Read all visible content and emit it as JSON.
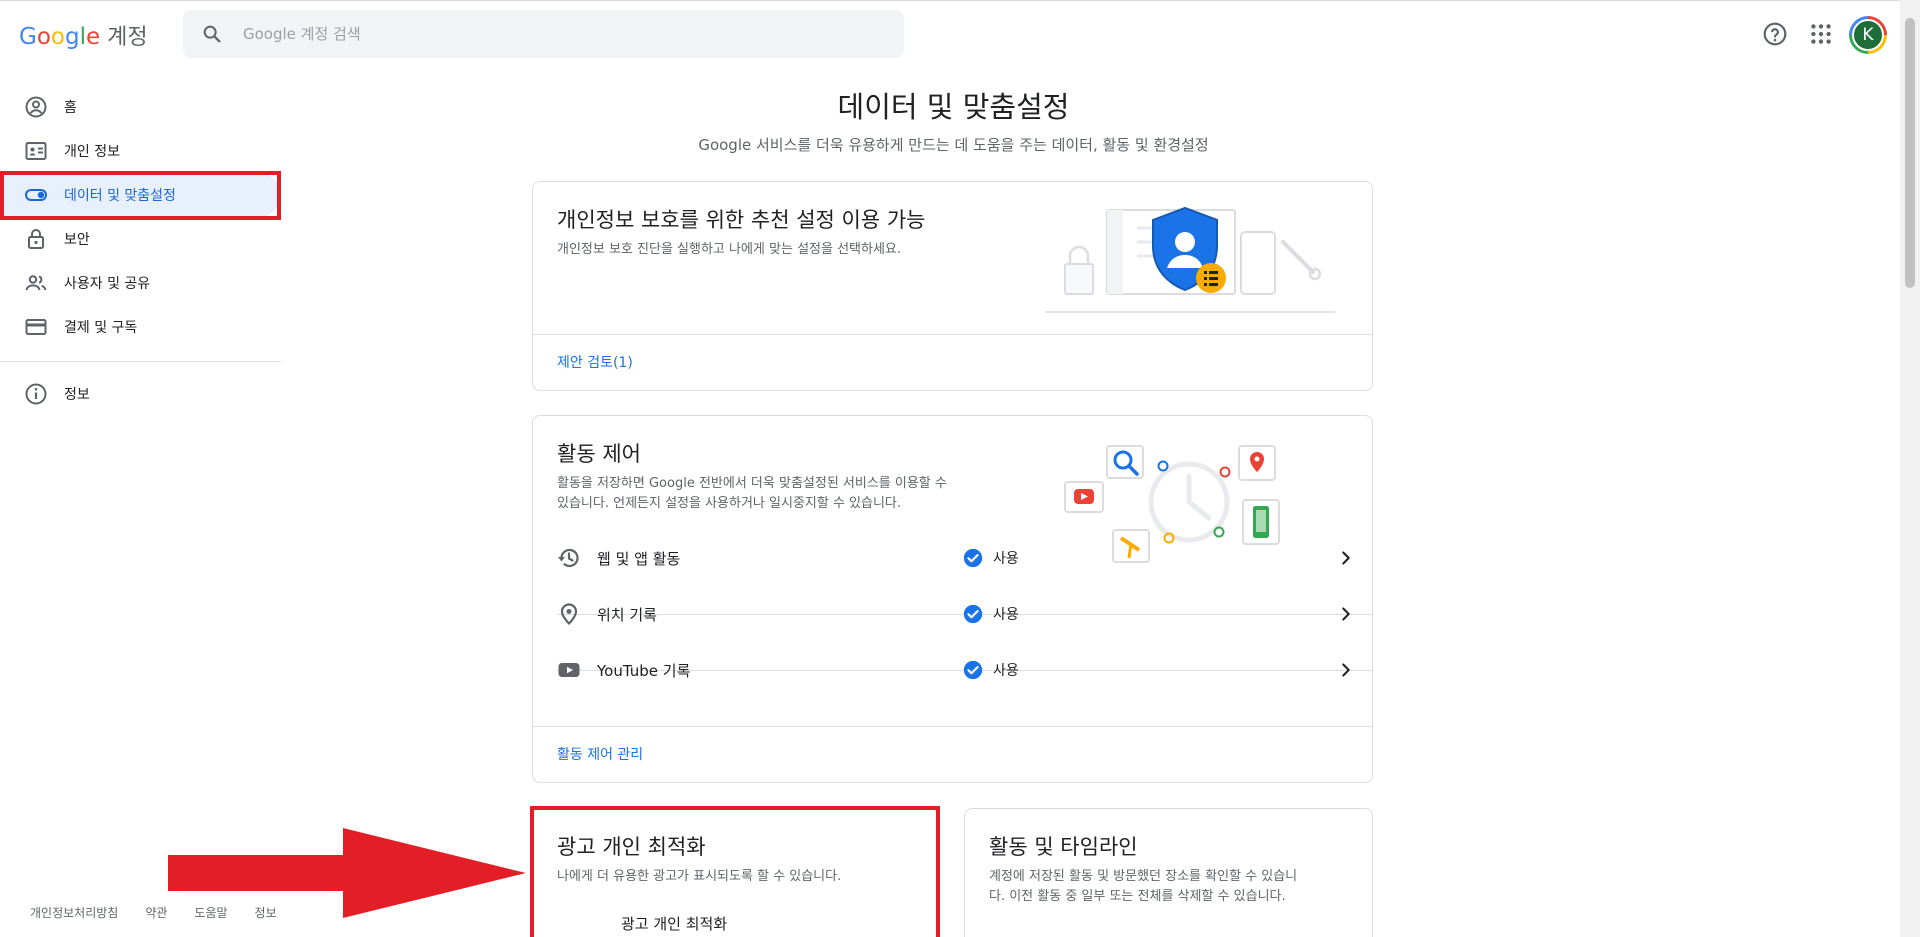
{
  "header": {
    "logo_google": [
      "G",
      "o",
      "o",
      "g",
      "l",
      "e"
    ],
    "product": "계정",
    "search_placeholder": "Google 계정 검색",
    "avatar_letter": "K"
  },
  "sidebar": {
    "items": [
      {
        "label": "홈",
        "icon": "account-circle-icon"
      },
      {
        "label": "개인 정보",
        "icon": "id-card-icon"
      },
      {
        "label": "데이터 및 맞춤설정",
        "icon": "toggle-icon",
        "active": true
      },
      {
        "label": "보안",
        "icon": "lock-icon"
      },
      {
        "label": "사용자 및 공유",
        "icon": "people-icon"
      },
      {
        "label": "결제 및 구독",
        "icon": "credit-card-icon"
      }
    ],
    "info_item": {
      "label": "정보",
      "icon": "info-icon"
    },
    "footer": [
      "개인정보처리방침",
      "약관",
      "도움말",
      "정보"
    ]
  },
  "main": {
    "title": "데이터 및 맞춤설정",
    "subtitle": "Google 서비스를 더욱 유용하게 만드는 데 도움을 주는 데이터, 활동 및 환경설정",
    "privacy_card": {
      "title": "개인정보 보호를 위한 추천 설정 이용 가능",
      "desc": "개인정보 보호 진단을 실행하고 나에게 맞는 설정을 선택하세요.",
      "link": "제안 검토(1)"
    },
    "activity_card": {
      "title": "활동 제어",
      "desc_line1": "활동을 저장하면 Google 전반에서 더욱 맞춤설정된 서비스를 이용할 수",
      "desc_line2": "있습니다. 언제든지 설정을 사용하거나 일시중지할 수 있습니다.",
      "rows": [
        {
          "label": "웹 및 앱 활동",
          "status": "사용",
          "icon": "history-icon"
        },
        {
          "label": "위치 기록",
          "status": "사용",
          "icon": "location-pin-icon"
        },
        {
          "label": "YouTube 기록",
          "status": "사용",
          "icon": "youtube-icon"
        }
      ],
      "link": "활동 제어 관리"
    },
    "ads_card": {
      "title": "광고 개인 최적화",
      "desc": "나에게 더 유용한 광고가 표시되도록 할 수 있습니다.",
      "row_label": "광고 개인 최적화"
    },
    "timeline_card": {
      "title": "활동 및 타임라인",
      "desc_line1": "계정에 저장된 활동 및 방문했던 장소를 확인할 수 있습니",
      "desc_line2": "다. 이전 활동 중 일부 또는 전체를 삭제할 수 있습니다."
    }
  },
  "colors": {
    "accent": "#1a73e8",
    "active_bg": "#e8f0fe",
    "highlight_red": "#e21f26"
  }
}
